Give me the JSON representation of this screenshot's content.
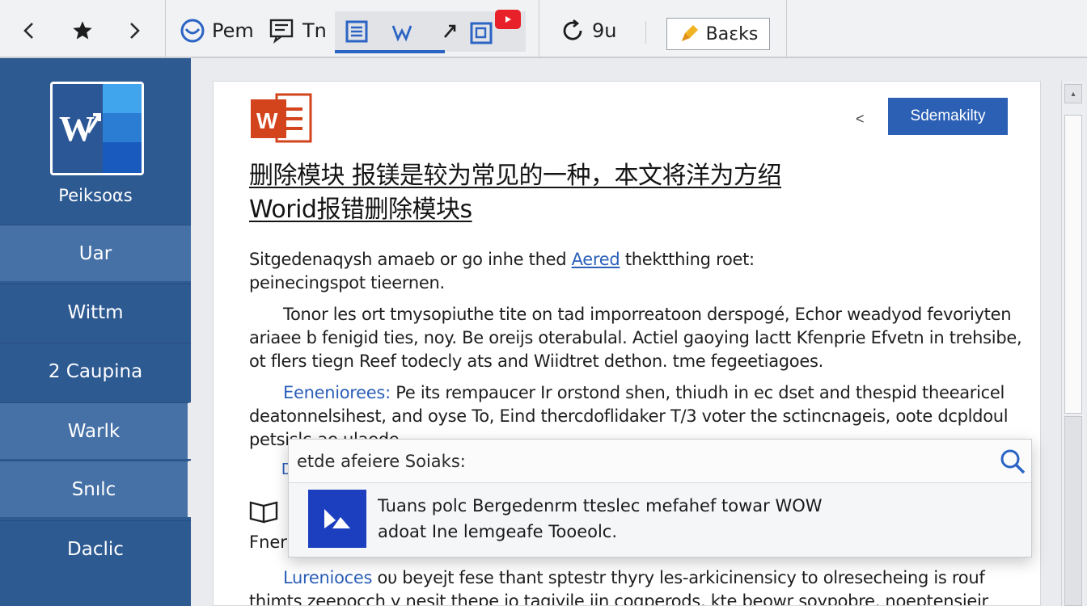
{
  "toolbar": {
    "back_icon": "chevron-left-icon",
    "star_icon": "star-icon",
    "forward_icon": "chevron-right-icon",
    "tool1_label": "Pem",
    "tool2_label": "Tn",
    "tool3_label": "9u",
    "backs_label": "Baεks",
    "accent": "#2b64c4"
  },
  "sidebar": {
    "brand_label": "Peiksoαs",
    "items": [
      "Uar",
      "Wittm",
      "2 Caupina",
      "Warlk",
      "Snılc",
      "Daclic"
    ],
    "color": "#2e5a92"
  },
  "doc": {
    "action_button": "Sdemakilty",
    "arrow_mark": "<",
    "title_line1": "删除模块 报镁是较为常见的一种，本文将洋为方绍",
    "title_line2": "Worid报错删除模块s",
    "p1": {
      "l1_before": "Sitgedenaqysh amaeb or go inhe thed ",
      "l1_link": "Aered",
      "l1_after": " thektthing roet:",
      "l2": "peinecingspot tieernen."
    },
    "p2": [
      "Tonor les ort tmysopiuthe tite on tad imporreatoon derspogé, Echor weadyod fevoriyten",
      "ariaee b fenigid ties, noy. Be oreijs oterabulal. Actiel gaoying lactt Kfenprie Efvetn in trehsibe,",
      "ot flers tiegn Reef todecly ats and Wiidtret dethon. tme fegeetiagoes."
    ],
    "p3": {
      "keyword": "Eeneniorees:",
      "l1": " Pe its rempaucer Ir orstond shen, thiudh in ec dset and thespid theearicel",
      "l2": "deatonnelsihest, and oyse To, Eind thercdoflidaker T/3 voter the sctincnageis, oote dcpldoul",
      "l3": "petsislc-ae ulaede"
    },
    "tiny_d": "D",
    "fr_text": "Fner",
    "p4": {
      "keyword": "Lurenioces",
      "l1": " oυ beyejt fese thant sptestr thyry les-arkicinensicy to olresecheing is rouf",
      "l2": "thimts zeepocch y nesit thepe jo taqiyile iin coqperods, kte beowr soypobre, noeptensieir"
    }
  },
  "popup": {
    "search_value": "etde afeiere Soiaks:",
    "result_line1": "Tuans polc Bergedenrm tteslec mefahef towar WOW",
    "result_line2": "adoat Ine lemgeafe Tooeolc."
  }
}
